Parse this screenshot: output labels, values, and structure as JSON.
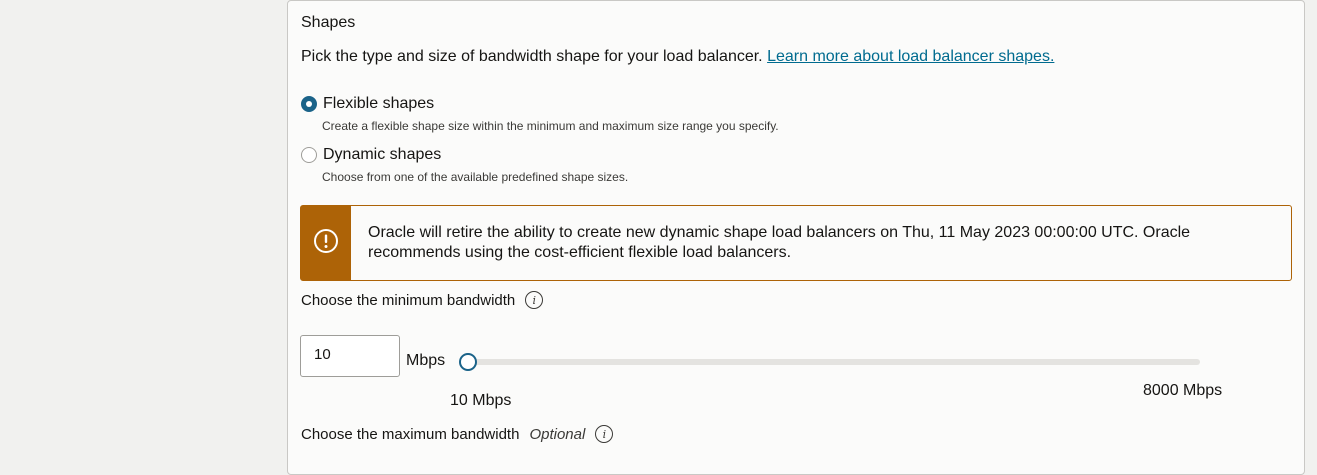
{
  "section": {
    "title": "Shapes",
    "description": "Pick the type and size of bandwidth shape for your load balancer.",
    "learn_more_link": "Learn more about load balancer shapes."
  },
  "shape_options": [
    {
      "label": "Flexible shapes",
      "help": "Create a flexible shape size within the minimum and maximum size range you specify.",
      "selected": true
    },
    {
      "label": "Dynamic shapes",
      "help": "Choose from one of the available predefined shape sizes.",
      "selected": false
    }
  ],
  "alert": {
    "icon": "warning-icon",
    "color": "#ad6307",
    "text": "Oracle will retire the ability to create new dynamic shape load balancers on Thu, 11 May 2023 00:00:00 UTC. Oracle recommends using the cost-efficient flexible load balancers."
  },
  "min_bandwidth": {
    "label": "Choose the minimum bandwidth",
    "value": "10",
    "unit": "Mbps",
    "slider_min_label": "10 Mbps",
    "slider_max_label": "8000 Mbps",
    "slider_value": 10
  },
  "max_bandwidth": {
    "label": "Choose the maximum bandwidth",
    "optional": "Optional"
  },
  "colors": {
    "accent": "#1b6389",
    "link": "#006b8f",
    "warning": "#ad6307"
  }
}
